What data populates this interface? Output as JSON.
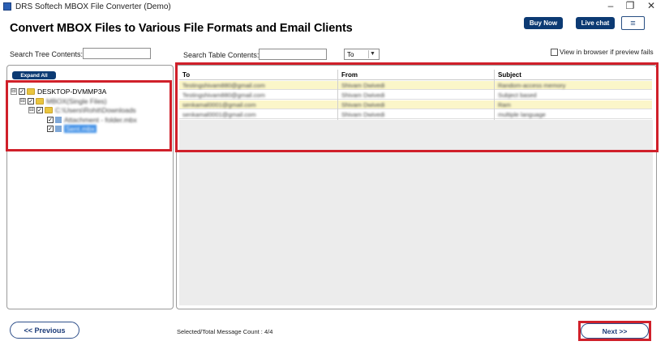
{
  "window": {
    "title": "DRS Softech MBOX File Converter (Demo)",
    "min_icon": "–",
    "restore_icon": "❐",
    "close_icon": "✕"
  },
  "header": {
    "title": "Convert MBOX Files to Various File Formats and Email Clients",
    "buy_now": "Buy Now",
    "live_chat": "Live chat",
    "menu_icon": "≡"
  },
  "search": {
    "tree_label": "Search Tree Contents:",
    "tree_value": "",
    "table_label": "Search Table Contents:",
    "table_value": "",
    "field_select": "To",
    "view_in_browser_label": "View in browser if preview fails"
  },
  "tree": {
    "expand_all": "Expand All",
    "nodes": [
      {
        "label": "DESKTOP-DVMMP3A",
        "toggle": "⊟",
        "checked": true
      },
      {
        "label": "MBOX(Single Files)",
        "toggle": "⊟",
        "checked": true
      },
      {
        "label": "C:\\Users\\Rohit\\Downloads",
        "toggle": "⊟",
        "checked": true
      },
      {
        "label": "Attachment - folder.mbx",
        "checked": true
      },
      {
        "label": "Sent.mbx",
        "checked": true
      }
    ]
  },
  "table": {
    "columns": [
      "To",
      "From",
      "Subject"
    ],
    "rows": [
      {
        "to": "Testingshivam880@gmail.com",
        "from": "Shivam Dwivedi",
        "subject": "Random-access memory"
      },
      {
        "to": "Testingshivam880@gmail.com",
        "from": "Shivam Dwivedi",
        "subject": "Subject based"
      },
      {
        "to": "senkamal0001@gmail.com",
        "from": "Shivam Dwivedi",
        "subject": "Ram"
      },
      {
        "to": "senkamal0001@gmail.com",
        "from": "Shivam Dwivedi",
        "subject": "multiple language"
      }
    ]
  },
  "footer": {
    "previous": "<< Previous",
    "next": "Next >>",
    "count": "Selected/Total Message Count : 4/4"
  },
  "colors": {
    "brand_navy": "#0c3a73",
    "highlight_red": "#d0202a",
    "row_highlight": "#fbf6c9"
  }
}
